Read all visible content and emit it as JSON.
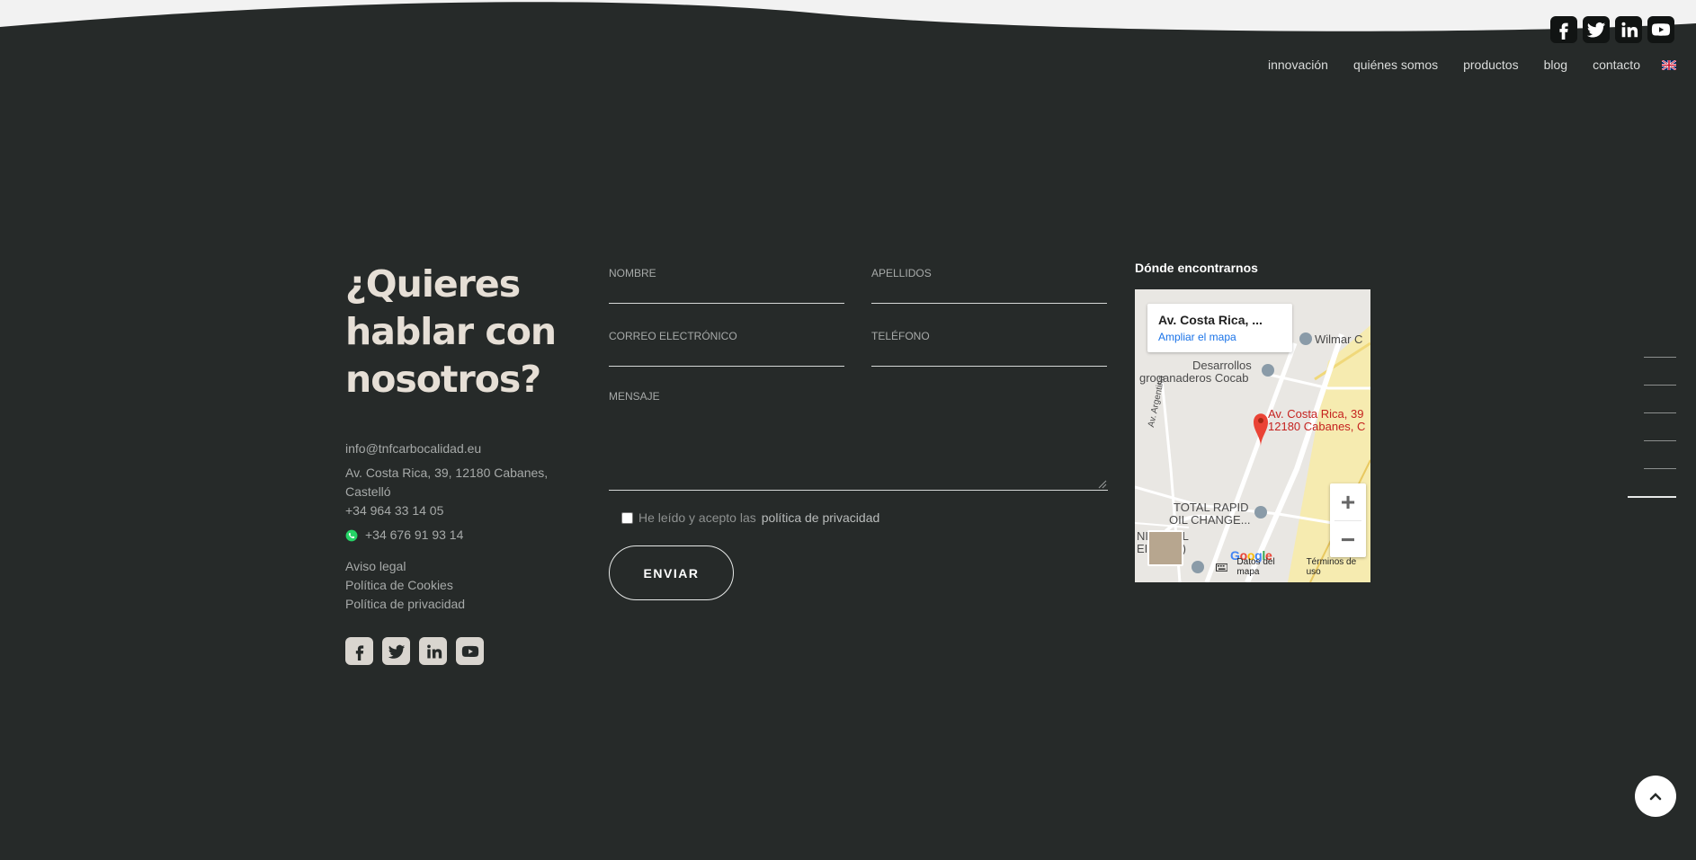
{
  "nav": {
    "items": [
      {
        "label": "innovación"
      },
      {
        "label": "quiénes somos"
      },
      {
        "label": "productos"
      },
      {
        "label": "blog"
      },
      {
        "label": "contacto"
      }
    ],
    "language_icon": "uk-flag-icon"
  },
  "social_icons": [
    "facebook-icon",
    "twitter-icon",
    "linkedin-icon",
    "youtube-icon"
  ],
  "contact": {
    "headline": "¿Quieres hablar con nosotros?",
    "email": "info@tnfcarbocalidad.eu",
    "address": "Av. Costa Rica, 39, 12180 Cabanes, Castelló",
    "phone": "+34 964 33 14 05",
    "whatsapp": "+34 676 91 93 14",
    "legal_links": [
      "Aviso legal",
      "Política de Cookies",
      "Política de privacidad"
    ]
  },
  "form": {
    "nombre_placeholder": "NOMBRE",
    "apellidos_placeholder": "APELLIDOS",
    "email_placeholder": "CORREO ELECTRÓNICO",
    "telefono_placeholder": "TELÉFONO",
    "mensaje_placeholder": "MENSAJE",
    "consent_prefix": "He leído y acepto las",
    "consent_link": "política de privacidad",
    "submit_label": "ENVIAR"
  },
  "map": {
    "title": "Dónde encontrarnos",
    "card_address": "Av. Costa Rica, ...",
    "card_link": "Ampliar el mapa",
    "pin_label_1": "Av. Costa Rica, 39",
    "pin_label_2": "12180 Cabanes, C",
    "place_1": "Wilmar C",
    "place_2a": "Desarrollos",
    "place_2b": "groganaderos Cocab",
    "place_3a": "TOTAL RAPID",
    "place_3b": "OIL CHANGE...",
    "place_4a": "NI    NS, SL",
    "place_4b": "EI       ANES)",
    "street": "Av. Argentina",
    "google": "Google",
    "footer_data": "Datos del mapa",
    "footer_terms": "Términos de uso",
    "zoom_in": "+",
    "zoom_out": "−"
  },
  "colors": {
    "background": "#262a29",
    "headline": "#e6dfd6",
    "accent_link": "#1a73e8",
    "whatsapp": "#25d366",
    "pin": "#ea4335"
  }
}
